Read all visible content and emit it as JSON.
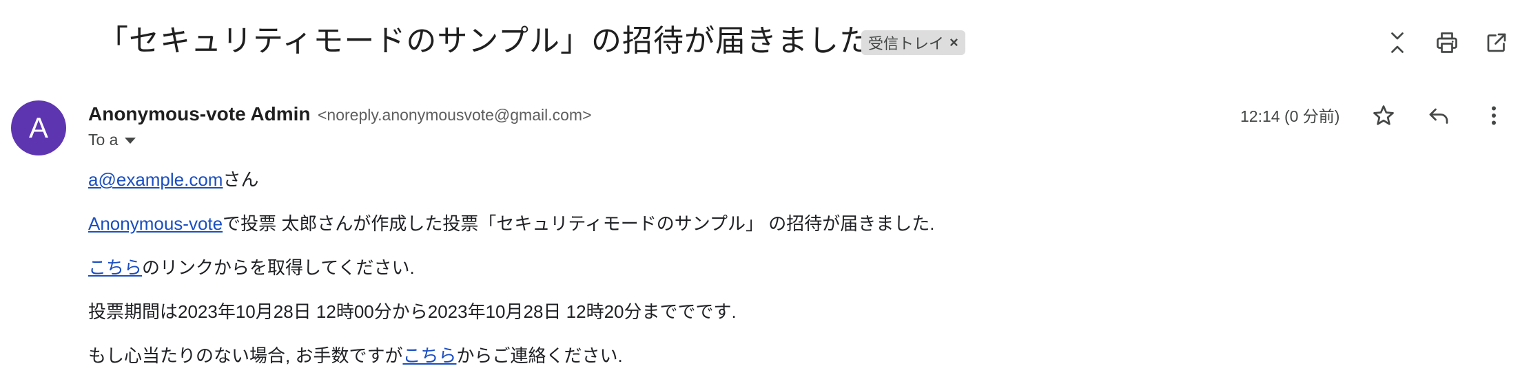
{
  "header": {
    "subject": "「セキュリティモードのサンプル」の招待が届きました",
    "label_chip": "受信トレイ",
    "chip_close": "×",
    "icons": [
      "collapse-icon",
      "print-icon",
      "open-in-new-window-icon"
    ]
  },
  "sender": {
    "avatar_letter": "A",
    "avatar_color": "#5e35b1",
    "name": "Anonymous-vote Admin",
    "email": "<noreply.anonymousvote@gmail.com>",
    "to_label": "To a",
    "timestamp": "12:14 (0 分前)",
    "icons": [
      "star-icon",
      "reply-icon",
      "more-vert-icon"
    ]
  },
  "body": {
    "line1": {
      "link": "a@example.com",
      "text": "さん"
    },
    "line2": {
      "link": "Anonymous-vote",
      "text": "で投票 太郎さんが作成した投票「セキュリティモードのサンプル」 の招待が届きました."
    },
    "line3": {
      "link": "こちら",
      "text": "のリンクからを取得してください."
    },
    "line4": {
      "text": "投票期間は2023年10月28日 12時00分から2023年10月28日 12時20分まででです."
    },
    "line5": {
      "text_before": "もし心当たりのない場合, お手数ですが",
      "link": "こちら",
      "text_after": "からご連絡ください."
    }
  },
  "colors": {
    "link": "#1a4ec2",
    "chip_bg": "#dddddd",
    "avatar": "#5e35b1"
  }
}
